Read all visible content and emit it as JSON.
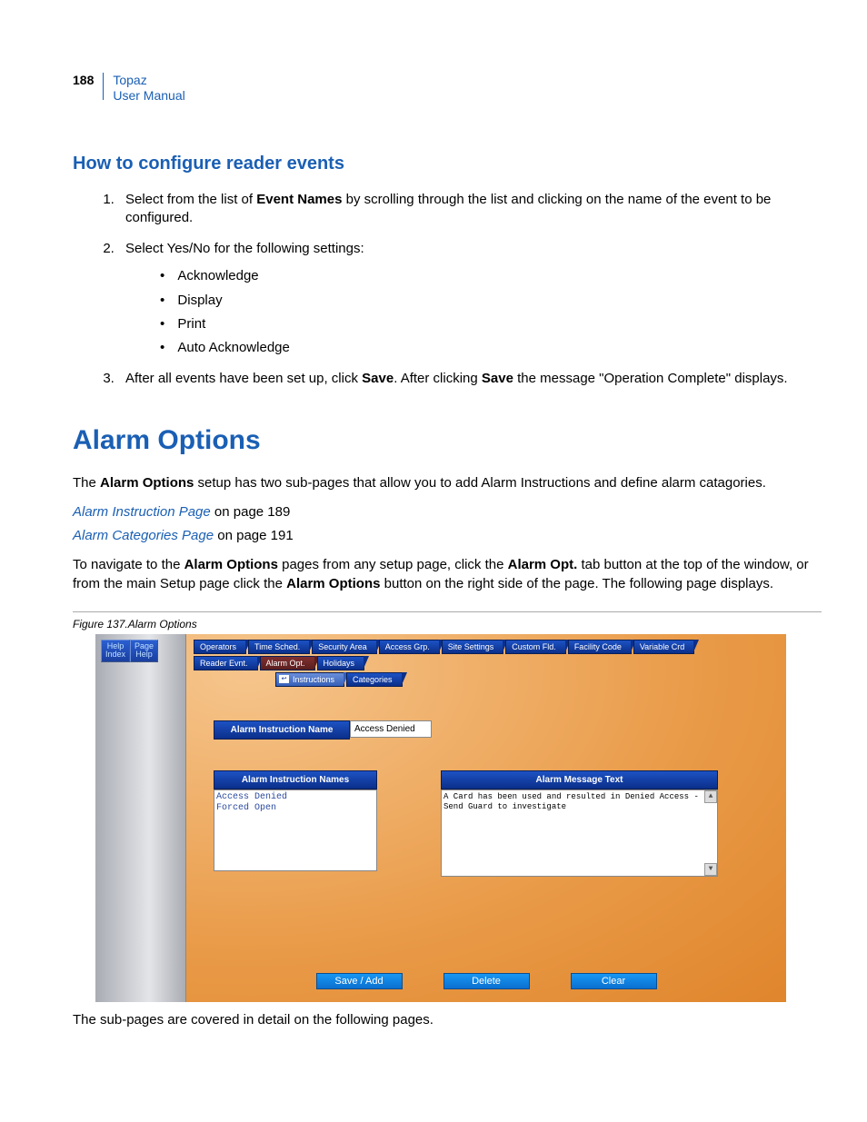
{
  "header": {
    "page_number": "188",
    "doc_title": "Topaz",
    "doc_subtitle": "User Manual"
  },
  "subhead": "How to configure reader events",
  "steps": {
    "s1_a": "Select from the list of ",
    "s1_b": "Event Names",
    "s1_c": " by scrolling through the list and clicking on the name of the event to be configured.",
    "s2": "Select Yes/No for the following settings:",
    "bullets": {
      "b1": "Acknowledge",
      "b2": "Display",
      "b3": "Print",
      "b4": "Auto Acknowledge"
    },
    "s3_a": "After all events have been set up, click ",
    "s3_b": "Save",
    "s3_c": ". After clicking ",
    "s3_d": "Save",
    "s3_e": " the message \"Operation Complete\" displays."
  },
  "mainhead": "Alarm Options",
  "intro_a": "The ",
  "intro_b": "Alarm Options",
  "intro_c": " setup has two sub-pages that allow you to add Alarm Instructions and define alarm catagories.",
  "link1_text": "Alarm Instruction Page",
  "link1_suffix": " on page 189",
  "link2_text": "Alarm Categories Page",
  "link2_suffix": " on page 191",
  "nav_a": "To navigate to the ",
  "nav_b": "Alarm Options",
  "nav_c": " pages from any setup page, click the ",
  "nav_d": "Alarm Opt.",
  "nav_e": " tab button at the top of the window, or from the main Setup page click the ",
  "nav_f": "Alarm Options",
  "nav_g": " button on the right side of the page. The following page displays.",
  "figure_caption": "Figure 137.Alarm Options",
  "shot": {
    "help_index": "Help\nIndex",
    "page_help": "Page\nHelp",
    "tabs_row1": [
      "Operators",
      "Time Sched.",
      "Security Area",
      "Access Grp.",
      "Site Settings",
      "Custom Fld.",
      "Facility Code",
      "Variable Crd"
    ],
    "tabs_row2": {
      "reader": "Reader Evnt.",
      "alarm_opt": "Alarm Opt.",
      "holidays": "Holidays"
    },
    "tabs_row3": {
      "instructions": "Instructions",
      "categories": "Categories"
    },
    "field_label": "Alarm Instruction Name",
    "field_value": "Access Denied",
    "list_label": "Alarm Instruction Names",
    "list_item1": "Access Denied",
    "list_item2": "Forced Open",
    "msg_label": "Alarm Message Text",
    "msg_text": "A Card has been used and resulted in Denied Access - Send Guard to investigate",
    "buttons": {
      "save": "Save / Add",
      "delete": "Delete",
      "clear": "Clear"
    }
  },
  "after_text": "The sub-pages are covered in detail on the following pages."
}
